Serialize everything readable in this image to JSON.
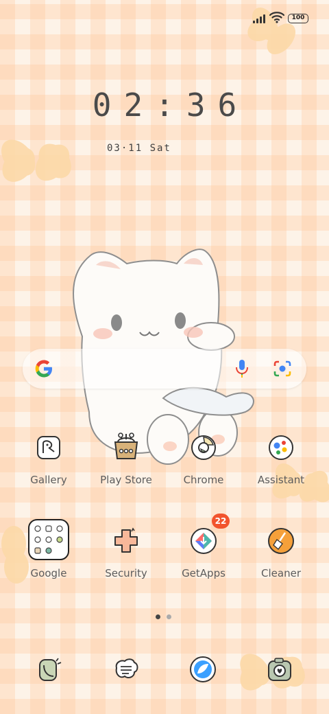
{
  "status_bar": {
    "battery": "100",
    "icons": [
      "cellular-signal-icon",
      "wifi-icon",
      "battery-icon"
    ]
  },
  "clock": {
    "time": "02:36",
    "date": "03·11 Sat"
  },
  "search": {
    "icons": [
      "google-g-icon",
      "voice-search-mic-icon",
      "google-lens-icon"
    ]
  },
  "apps_row1": [
    {
      "label": "Gallery",
      "icon": "gallery-icon"
    },
    {
      "label": "Play Store",
      "icon": "play-store-basket-icon"
    },
    {
      "label": "Chrome",
      "icon": "chrome-icon"
    },
    {
      "label": "Assistant",
      "icon": "assistant-icon"
    }
  ],
  "apps_row2": [
    {
      "label": "Google",
      "icon": "google-folder-icon"
    },
    {
      "label": "Security",
      "icon": "security-icon"
    },
    {
      "label": "GetApps",
      "icon": "getapps-icon",
      "badge": "22"
    },
    {
      "label": "Cleaner",
      "icon": "cleaner-broom-icon"
    }
  ],
  "pager": {
    "pages": 2,
    "current": 1
  },
  "dock": [
    {
      "icon": "phone-icon"
    },
    {
      "icon": "messages-icon"
    },
    {
      "icon": "browser-icon"
    },
    {
      "icon": "camera-icon"
    }
  ],
  "colors": {
    "badge": "#f2542d",
    "background": "#fdf3e8",
    "check": "#ffc496"
  }
}
